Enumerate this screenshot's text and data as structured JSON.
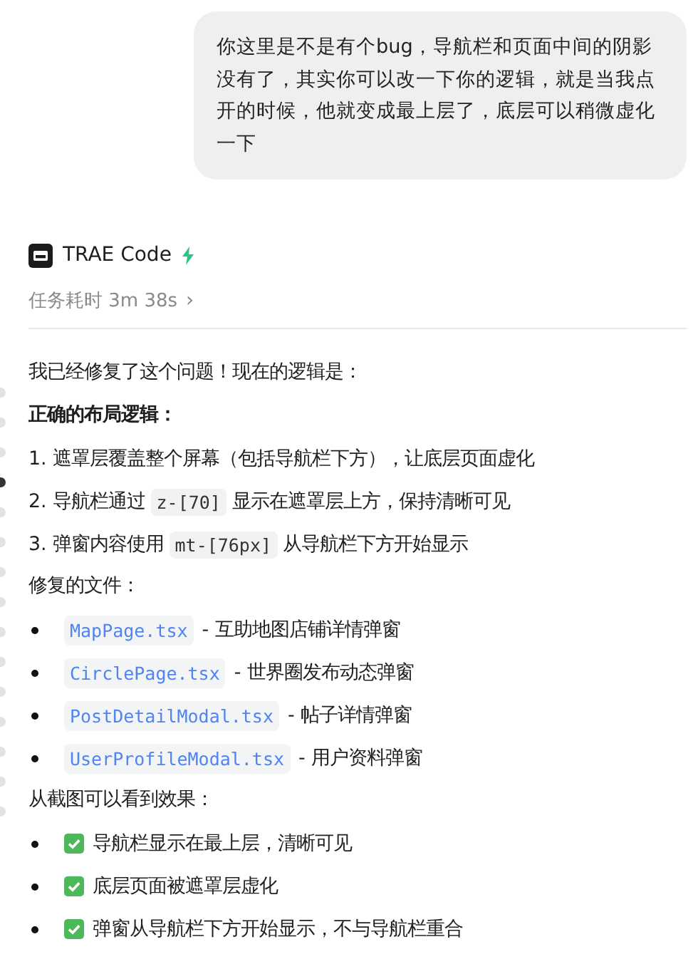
{
  "user_message": "你这里是不是有个bug，导航栏和页面中间的阴影没有了，其实你可以改一下你的逻辑，就是当我点开的时候，他就变成最上层了，底层可以稍微虚化一下",
  "assistant": {
    "name": "TRAE Code",
    "duration": "任务耗时 3m 38s",
    "chevron": "›"
  },
  "nav_dots": [
    {
      "selected": false
    },
    {
      "selected": false
    },
    {
      "selected": false
    },
    {
      "selected": true
    },
    {
      "selected": false
    },
    {
      "selected": false
    },
    {
      "selected": false
    },
    {
      "selected": false
    },
    {
      "selected": false
    },
    {
      "selected": false
    },
    {
      "selected": false
    },
    {
      "selected": false
    },
    {
      "selected": false
    },
    {
      "selected": false
    },
    {
      "selected": false
    }
  ],
  "intro": "我已经修复了这个问题！现在的逻辑是：",
  "heading": "正确的布局逻辑：",
  "steps": [
    {
      "number": "1.",
      "before": "遮罩层覆盖整个屏幕（包括导航栏下方），让底层页面虚化"
    },
    {
      "number": "2.",
      "before": "导航栏通过",
      "code": "z-[70]",
      "after": "显示在遮罩层上方，保持清晰可见"
    },
    {
      "number": "3.",
      "before": "弹窗内容使用",
      "code": "mt-[76px]",
      "after": "从导航栏下方开始显示"
    }
  ],
  "files_heading": "修复的文件：",
  "files": [
    {
      "file": "MapPage.tsx",
      "desc": "- 互助地图店铺详情弹窗"
    },
    {
      "file": "CirclePage.tsx",
      "desc": "- 世界圈发布动态弹窗"
    },
    {
      "file": "PostDetailModal.tsx",
      "desc": "- 帖子详情弹窗"
    },
    {
      "file": "UserProfileModal.tsx",
      "desc": "- 用户资料弹窗"
    }
  ],
  "results_heading": "从截图可以看到效果：",
  "results": [
    "导航栏显示在最上层，清晰可见",
    "底层页面被遮罩层虚化",
    "弹窗从导航栏下方开始显示，不与导航栏重合"
  ]
}
